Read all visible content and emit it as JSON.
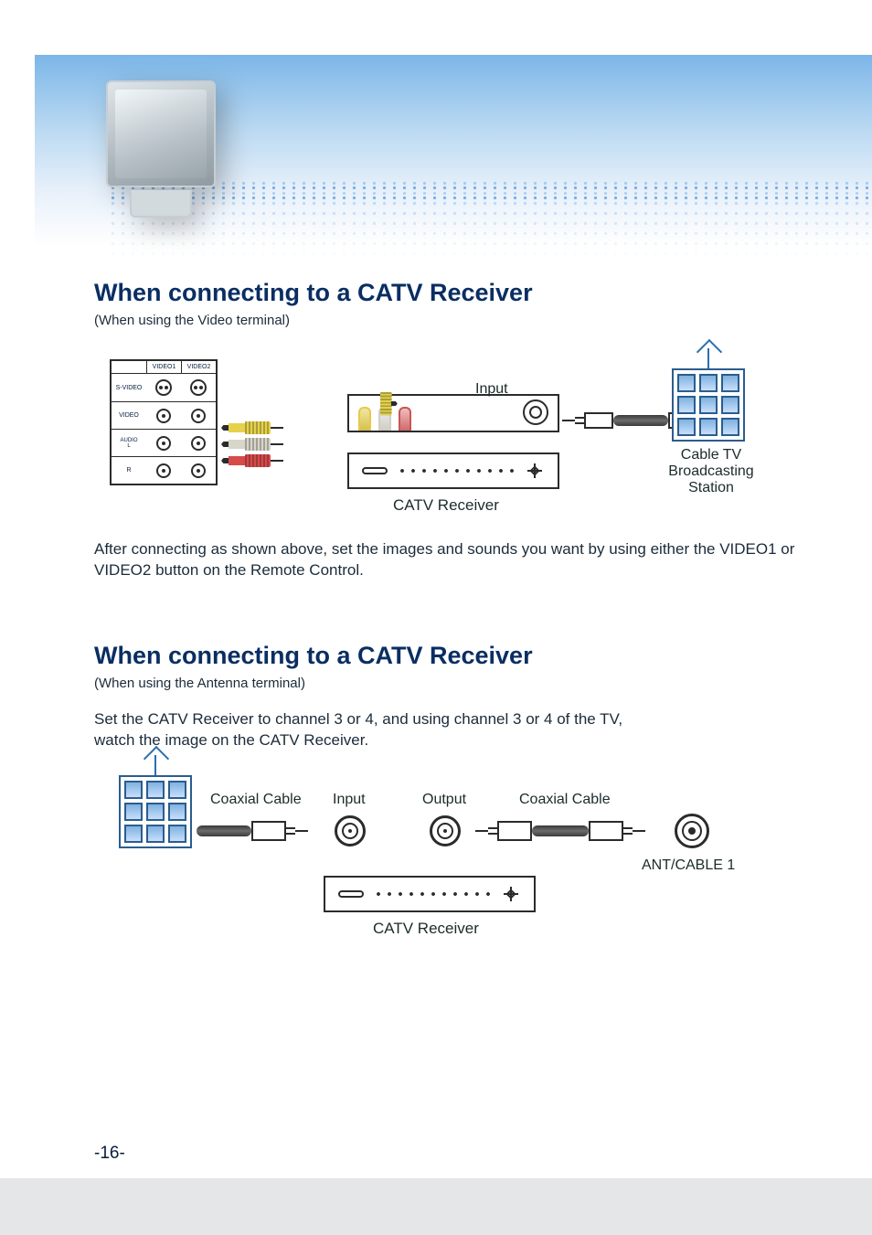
{
  "header": {},
  "section1": {
    "title": "When connecting to a CATV Receiver",
    "subtitle": "(When using the Video terminal)",
    "body": "After connecting as shown above, set the images and sounds you want by using either the VIDEO1 or VIDEO2 button on the Remote Control.",
    "labels": {
      "input": "Input",
      "catv_receiver": "CATV Receiver",
      "broadcast": "Cable TV\nBroadcasting\nStation"
    }
  },
  "io_panel": {
    "col1": "VIDEO1",
    "col2": "VIDEO2",
    "rows": {
      "svideo": "S-VIDEO",
      "video": "VIDEO",
      "audio": "AUDIO",
      "l": "L",
      "r": "R"
    }
  },
  "section2": {
    "title": "When connecting to a CATV Receiver",
    "subtitle": "(When using the Antenna terminal)",
    "body_lines": [
      "Set the CATV Receiver to channel 3 or 4, and using channel 3 or 4 of the TV,",
      "watch the image on the CATV Receiver."
    ],
    "labels": {
      "coax_left": "Coaxial Cable",
      "input": "Input",
      "output": "Output",
      "coax_right": "Coaxial Cable",
      "ant_port": "ANT/CABLE 1",
      "catv_receiver": "CATV Receiver"
    }
  },
  "page_number": "-16-"
}
